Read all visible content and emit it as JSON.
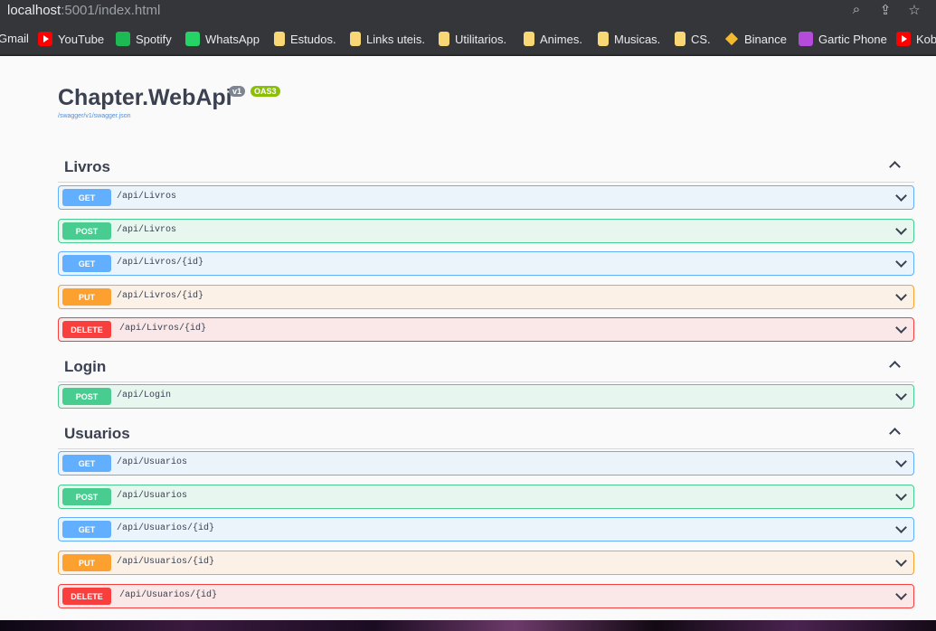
{
  "browser": {
    "url_host": "localhost",
    "url_rest": ":5001/index.html",
    "bookmarks": [
      {
        "label": "Gmail",
        "icon": "gmail-icon"
      },
      {
        "label": "YouTube",
        "icon": "youtube-icon"
      },
      {
        "label": "Spotify",
        "icon": "spotify-icon"
      },
      {
        "label": "WhatsApp",
        "icon": "whatsapp-icon"
      },
      {
        "label": "Estudos.",
        "icon": "folder-icon"
      },
      {
        "label": "Links uteis.",
        "icon": "folder-icon"
      },
      {
        "label": "Utilitarios.",
        "icon": "folder-icon"
      },
      {
        "label": "Animes.",
        "icon": "folder-icon"
      },
      {
        "label": "Musicas.",
        "icon": "folder-icon"
      },
      {
        "label": "CS.",
        "icon": "folder-icon"
      },
      {
        "label": "Binance",
        "icon": "binance-icon"
      },
      {
        "label": "Gartic Phone",
        "icon": "gartic-phone-icon"
      },
      {
        "label": "Kob",
        "icon": "youtube-icon"
      }
    ]
  },
  "api": {
    "title": "Chapter.WebApi",
    "version_badge": "v1",
    "oas_badge": "OAS3",
    "spec_link": "/swagger/v1/swagger.json"
  },
  "tags": [
    {
      "name": "Livros",
      "operations": [
        {
          "method": "GET",
          "path": "/api/Livros"
        },
        {
          "method": "POST",
          "path": "/api/Livros"
        },
        {
          "method": "GET",
          "path": "/api/Livros/{id}"
        },
        {
          "method": "PUT",
          "path": "/api/Livros/{id}"
        },
        {
          "method": "DELETE",
          "path": "/api/Livros/{id}"
        }
      ]
    },
    {
      "name": "Login",
      "operations": [
        {
          "method": "POST",
          "path": "/api/Login"
        }
      ]
    },
    {
      "name": "Usuarios",
      "operations": [
        {
          "method": "GET",
          "path": "/api/Usuarios"
        },
        {
          "method": "POST",
          "path": "/api/Usuarios"
        },
        {
          "method": "GET",
          "path": "/api/Usuarios/{id}"
        },
        {
          "method": "PUT",
          "path": "/api/Usuarios/{id}"
        },
        {
          "method": "DELETE",
          "path": "/api/Usuarios/{id}"
        }
      ]
    }
  ],
  "colors": {
    "get": "#61affe",
    "post": "#49cc90",
    "put": "#fca130",
    "delete": "#f93e3e"
  }
}
